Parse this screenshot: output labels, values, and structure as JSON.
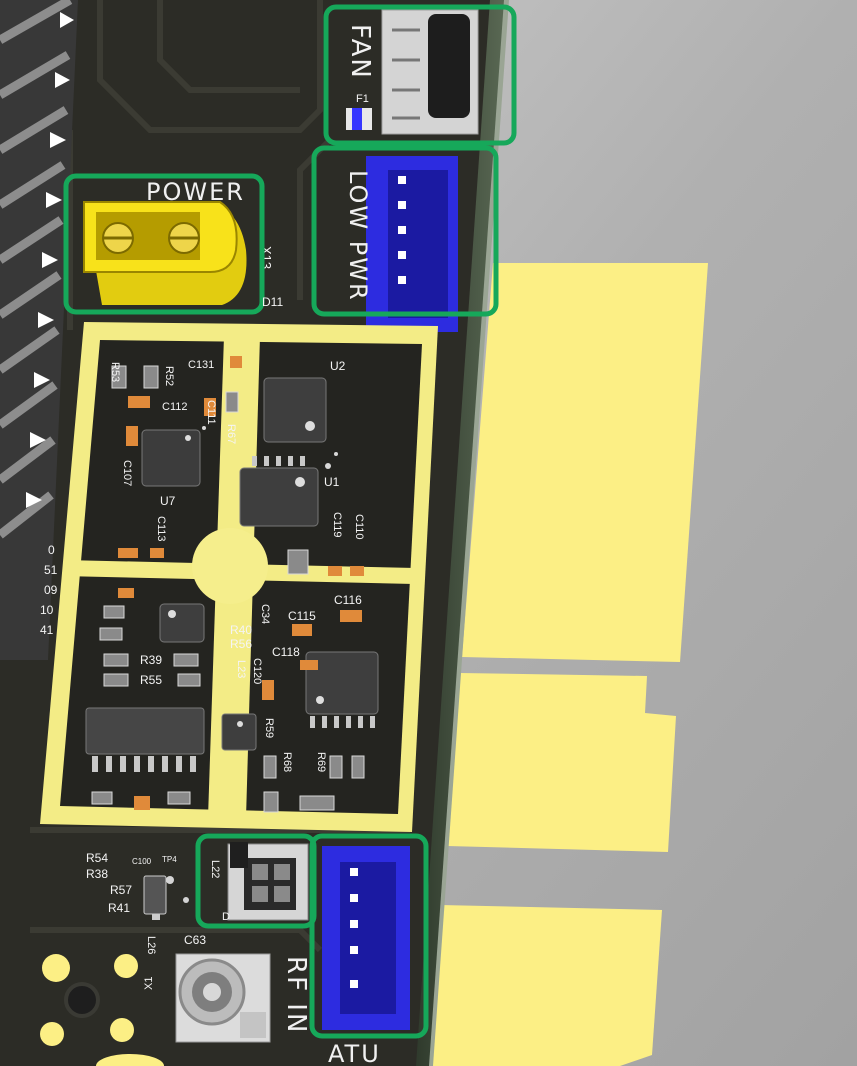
{
  "title": "",
  "connectors": {
    "fan": {
      "label": "FAN",
      "fuse": "F1"
    },
    "low_pwr": {
      "label": "LOW PWR"
    },
    "power": {
      "label": "POWER",
      "refdes": "X13"
    },
    "rf_in": {
      "label": "RF IN"
    },
    "atu": {
      "label": "ATU"
    }
  },
  "colors": {
    "highlight_box": "#16a85a",
    "board": "#2c2c26",
    "shield": "#f3ec86",
    "connector_blue": "#2d2ce0",
    "fan_connector": "#c9c9c9",
    "pads_yellow": "#fcef85",
    "background_gray": "#a9a9a9"
  },
  "refdes": {
    "r53": "R53",
    "r52": "R52",
    "c131": "C131",
    "u2": "U2",
    "c112": "C112",
    "c111": "C111",
    "r67": "R67",
    "c107": "C107",
    "u7": "U7",
    "u1": "U1",
    "c113": "C113",
    "c119": "C119",
    "c110": "C110",
    "c116": "C116",
    "c115": "C115",
    "c34": "C34",
    "r40": "R40",
    "r56": "R56",
    "r39": "R39",
    "r55": "R55",
    "c118": "C118",
    "c120": "C120",
    "l23": "L23",
    "r59": "R59",
    "r68": "R68",
    "r69": "R69",
    "d11": "D11",
    "r54": "R54",
    "r38": "R38",
    "c100": "C100",
    "tp4": "TP4",
    "r57": "R57",
    "r41": "R41",
    "l26": "L26",
    "c63": "C63",
    "x1": "X1",
    "l22": "L22",
    "d": "D",
    "edge_a": "0",
    "edge_b": "51",
    "edge_c": "09",
    "edge_d": "10",
    "edge_e": "41"
  }
}
